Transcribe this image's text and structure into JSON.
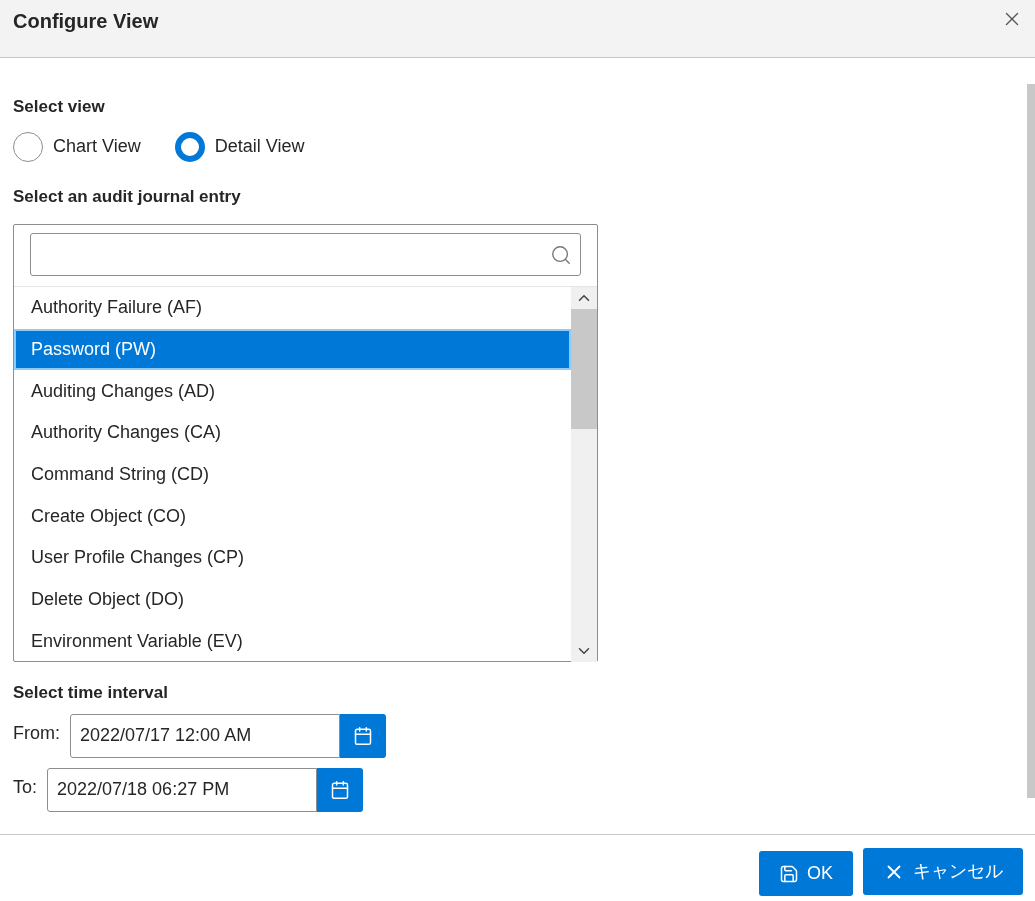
{
  "dialog": {
    "title": "Configure View"
  },
  "view_section": {
    "label": "Select view",
    "options": [
      {
        "label": "Chart View",
        "selected": false
      },
      {
        "label": "Detail View",
        "selected": true
      }
    ]
  },
  "entry_section": {
    "label": "Select an audit journal entry",
    "items": [
      {
        "label": "Authority Failure (AF)",
        "selected": false
      },
      {
        "label": "Password (PW)",
        "selected": true
      },
      {
        "label": "Auditing Changes (AD)",
        "selected": false
      },
      {
        "label": "Authority Changes (CA)",
        "selected": false
      },
      {
        "label": "Command String (CD)",
        "selected": false
      },
      {
        "label": "Create Object (CO)",
        "selected": false
      },
      {
        "label": "User Profile Changes (CP)",
        "selected": false
      },
      {
        "label": "Delete Object (DO)",
        "selected": false
      },
      {
        "label": "Environment Variable (EV)",
        "selected": false
      }
    ]
  },
  "time_section": {
    "label": "Select time interval",
    "fields": [
      {
        "label": "From:",
        "value": "2022/07/17 12:00 AM"
      },
      {
        "label": "To:",
        "value": "2022/07/18 06:27 PM"
      }
    ]
  },
  "buttons": [
    {
      "kind": "save",
      "label": "OK"
    },
    {
      "kind": "cancel",
      "label": "キャンセル"
    }
  ]
}
